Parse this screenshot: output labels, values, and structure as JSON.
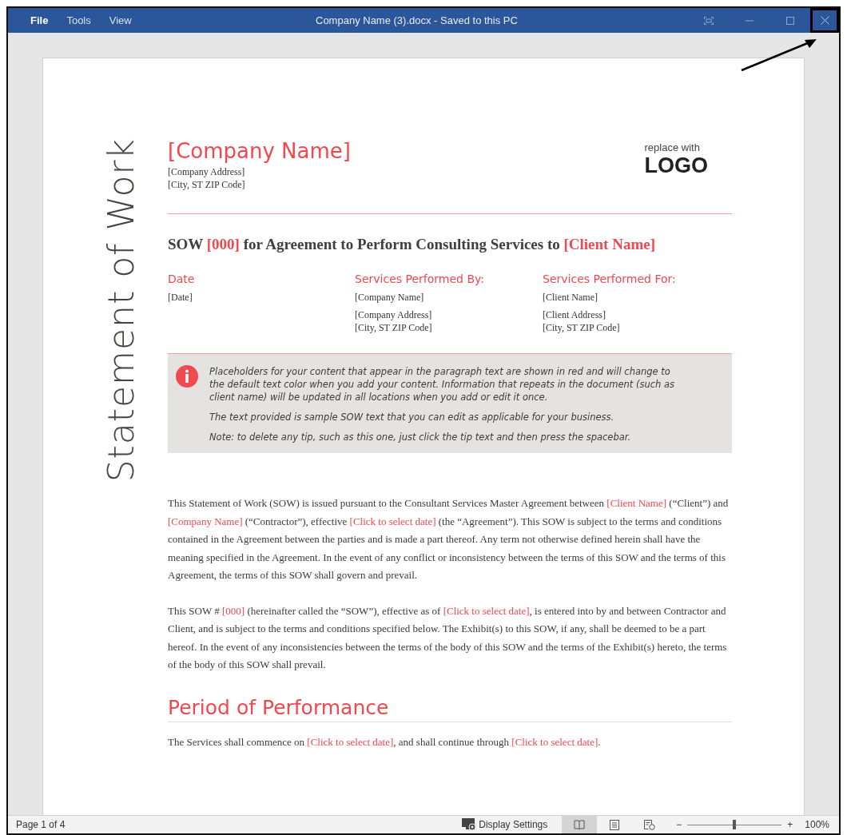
{
  "window": {
    "title": "Company Name (3).docx -  Saved to this PC",
    "menu": [
      {
        "label": "File",
        "selected": true
      },
      {
        "label": "Tools",
        "selected": false
      },
      {
        "label": "View",
        "selected": false
      }
    ],
    "close_highlighted": true
  },
  "document": {
    "side_title": "Statement of Work",
    "company_name": "[Company Name]",
    "company_address": "[Company Address]",
    "company_city": "[City, ST  ZIP Code]",
    "logo_caption": "replace with",
    "logo_text": "LOGO",
    "heading": [
      {
        "kind": "plain",
        "text": "SOW "
      },
      {
        "kind": "placeholder",
        "text": "[000]"
      },
      {
        "kind": "plain",
        "text": " for Agreement to Perform Consulting Services to "
      },
      {
        "kind": "placeholder",
        "text": "[Client Name]"
      }
    ],
    "columns": [
      {
        "label": "Date",
        "lines": [
          "[Date]"
        ]
      },
      {
        "label": "Services Performed By:",
        "lines": [
          "[Company Name]",
          "[Company Address]\n[City, ST  ZIP Code]"
        ]
      },
      {
        "label": "Services Performed For:",
        "lines": [
          "[Client Name]",
          "[Client Address]\n[City, ST  ZIP Code]"
        ]
      }
    ],
    "tip": [
      "Placeholders for your content that appear in the paragraph text are shown in red and will change to the default text color when you add your content. Information that repeats in the document (such as client name) will be updated in all locations when you add or edit it once.",
      "The text provided is sample SOW text that you can edit as applicable for your business.",
      "Note: to delete any tip, such as this one, just click the tip text and then press the spacebar."
    ],
    "paragraphs": [
      [
        {
          "kind": "plain",
          "text": "This Statement of Work (SOW) is issued pursuant to the Consultant Services Master Agreement between "
        },
        {
          "kind": "placeholder",
          "text": "[Client Name]"
        },
        {
          "kind": "plain",
          "text": " (“Client”) and "
        },
        {
          "kind": "placeholder",
          "text": "[Company Name]"
        },
        {
          "kind": "plain",
          "text": " (“Contractor”), effective "
        },
        {
          "kind": "placeholder",
          "text": "[Click to select date]"
        },
        {
          "kind": "plain",
          "text": " (the “Agreement”). This SOW is subject to the terms and conditions contained in the Agreement between the parties and is made a part thereof. Any term not otherwise defined herein shall have the meaning specified in the Agreement. In the event of any conflict or inconsistency between the terms of this SOW and the terms of this Agreement, the terms of this SOW shall govern and prevail."
        }
      ],
      [
        {
          "kind": "plain",
          "text": "This SOW # "
        },
        {
          "kind": "placeholder",
          "text": "[000]"
        },
        {
          "kind": "plain",
          "text": " (hereinafter called the “SOW”), effective as of "
        },
        {
          "kind": "placeholder",
          "text": "[Click to select date]"
        },
        {
          "kind": "plain",
          "text": ", is entered into by and between Contractor and Client, and is subject to the terms and conditions specified below. The Exhibit(s) to this SOW, if any, shall be deemed to be a part hereof. In the event of any inconsistencies between the terms of the body of this SOW and the terms of the Exhibit(s) hereto, the terms of the body of this SOW shall prevail."
        }
      ]
    ],
    "section_heading": "Period of Performance",
    "section_paragraph": [
      {
        "kind": "plain",
        "text": "The Services shall commence on "
      },
      {
        "kind": "placeholder",
        "text": "[Click to select date]"
      },
      {
        "kind": "plain",
        "text": ", and shall continue through "
      },
      {
        "kind": "placeholder",
        "text": "[Click to select date]"
      },
      {
        "kind": "plain",
        "text": "."
      }
    ]
  },
  "status_bar": {
    "page": "Page 1 of 4",
    "display_settings": "Display Settings",
    "views": [
      {
        "kind": "read",
        "selected": true
      },
      {
        "kind": "print",
        "selected": false
      },
      {
        "kind": "web",
        "selected": false
      }
    ],
    "zoom": {
      "level": 0.5,
      "minus": "−",
      "plus": "+",
      "reading": "100%"
    }
  }
}
